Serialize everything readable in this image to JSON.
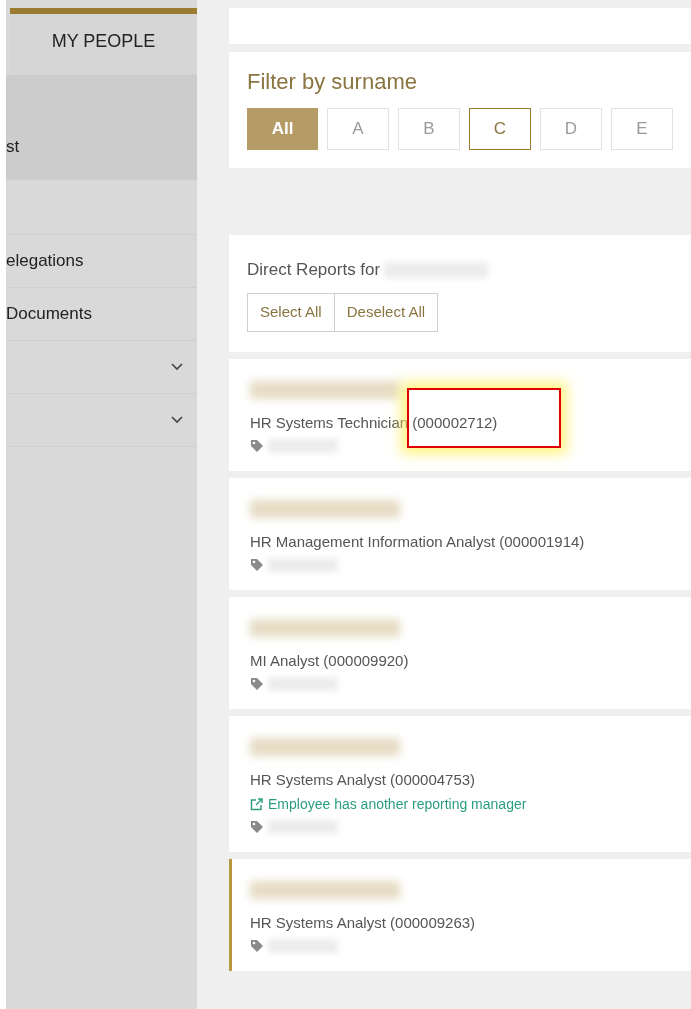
{
  "sidebar": {
    "tab": {
      "label": "MY PEOPLE",
      "selected": true
    },
    "items": [
      {
        "kind": "text",
        "label": "st",
        "selected": true
      },
      {
        "kind": "blank"
      },
      {
        "kind": "text",
        "label": "elegations",
        "selected": false
      },
      {
        "kind": "text",
        "label": "Documents",
        "selected": false
      },
      {
        "kind": "group",
        "expanded": false
      },
      {
        "kind": "group",
        "expanded": false
      }
    ]
  },
  "filter": {
    "title": "Filter by surname",
    "letters": [
      {
        "label": "All",
        "selected": true,
        "enabled": true
      },
      {
        "label": "A",
        "selected": false,
        "enabled": false
      },
      {
        "label": "B",
        "selected": false,
        "enabled": false
      },
      {
        "label": "C",
        "selected": false,
        "enabled": true
      },
      {
        "label": "D",
        "selected": false,
        "enabled": false
      },
      {
        "label": "E",
        "selected": false,
        "enabled": false
      }
    ]
  },
  "direct_reports": {
    "heading": "Direct Reports for",
    "buttons": [
      "Select All",
      "Deselect All"
    ]
  },
  "employees": [
    {
      "title": "HR Systems Technician (000002712)",
      "selected": false,
      "highlighted": true
    },
    {
      "title": "HR Management Information Analyst (000001914)",
      "selected": false,
      "highlighted": false
    },
    {
      "title": "MI Analyst (000009920)",
      "selected": false,
      "highlighted": false
    },
    {
      "title": "HR Systems Analyst (000004753)",
      "link": "Employee has another reporting manager",
      "selected": false,
      "highlighted": false
    },
    {
      "title": "HR Systems Analyst (000009263)",
      "selected": true,
      "highlighted": false
    }
  ]
}
